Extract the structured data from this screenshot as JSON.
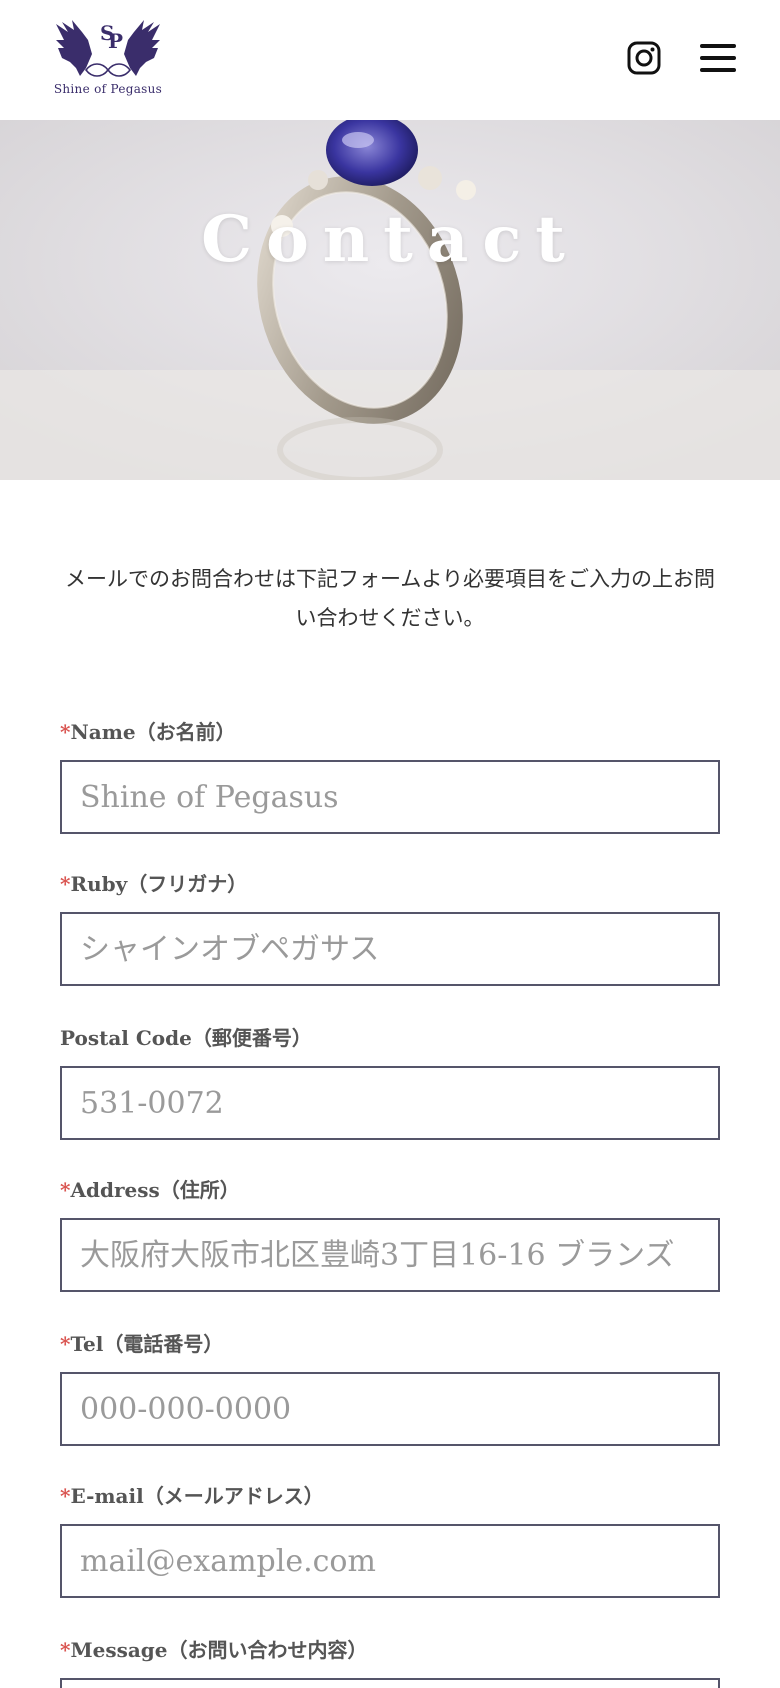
{
  "header": {
    "logo_text": "Shine of Pegasus",
    "logo_icon": "pegasus-sp-crest-icon",
    "instagram_icon": "instagram-icon",
    "menu_icon": "hamburger-menu-icon"
  },
  "hero": {
    "title": "Contact"
  },
  "intro": {
    "text": "メールでのお問合わせは下記フォームより必要項目をご入力の上お問い合わせください。"
  },
  "form": {
    "required_mark": "*",
    "fields": [
      {
        "label": "Name（お名前）",
        "required": true,
        "placeholder": "Shine of Pegasus"
      },
      {
        "label": "Ruby（フリガナ）",
        "required": true,
        "placeholder": "シャインオブペガサス"
      },
      {
        "label": "Postal Code（郵便番号）",
        "required": false,
        "placeholder": "531-0072"
      },
      {
        "label": "Address（住所）",
        "required": true,
        "placeholder": "大阪府大阪市北区豊崎3丁目16-16 ブランズ"
      },
      {
        "label": "Tel（電話番号）",
        "required": true,
        "placeholder": "000-000-0000"
      },
      {
        "label": "E-mail（メールアドレス）",
        "required": true,
        "placeholder": "mail@example.com"
      },
      {
        "label": "Message（お問い合わせ内容）",
        "required": true
      }
    ]
  },
  "colors": {
    "brand": "#3a2d6b",
    "required": "#d9534f",
    "input_border": "#55556a"
  }
}
